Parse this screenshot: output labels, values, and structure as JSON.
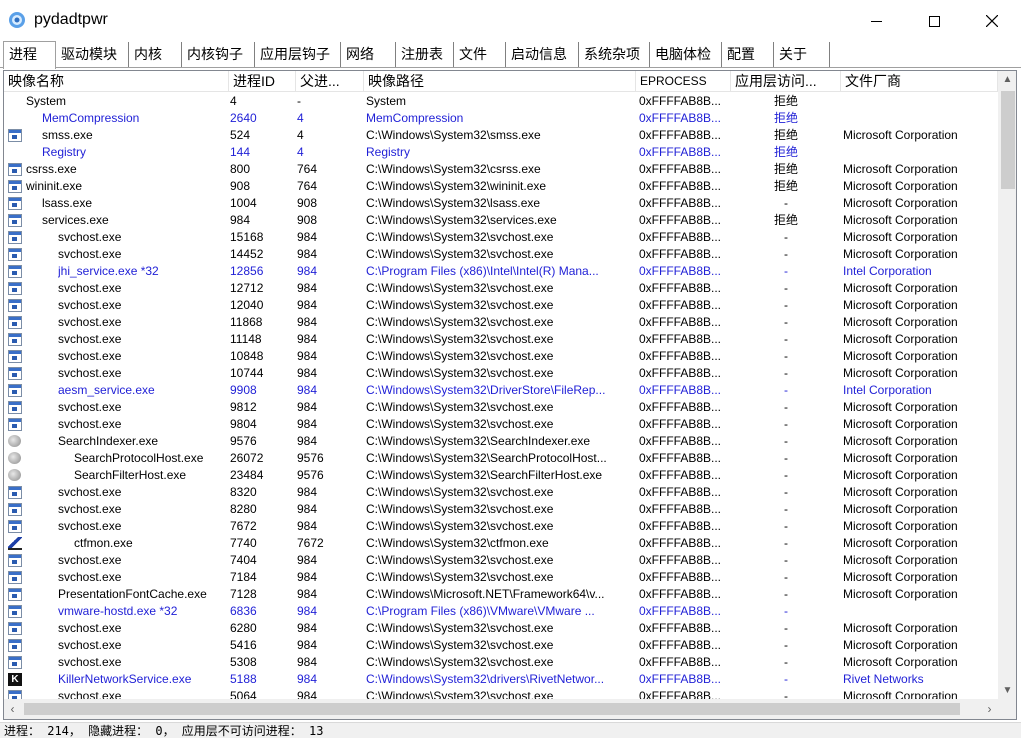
{
  "window": {
    "title": "pydadtpwr",
    "icon": "gear-flower-icon",
    "controls": [
      "minimize-icon",
      "maximize-icon",
      "close-icon"
    ]
  },
  "tabs": [
    {
      "label": "进程",
      "active": true
    },
    {
      "label": "驱动模块"
    },
    {
      "label": "内核"
    },
    {
      "label": "内核钩子"
    },
    {
      "label": "应用层钩子"
    },
    {
      "label": "网络"
    },
    {
      "label": "注册表"
    },
    {
      "label": "文件"
    },
    {
      "label": "启动信息"
    },
    {
      "label": "系统杂项"
    },
    {
      "label": "电脑体检"
    },
    {
      "label": "配置"
    },
    {
      "label": "关于"
    }
  ],
  "columns": [
    "映像名称",
    "进程ID",
    "父进...",
    "映像路径",
    "EPROCESS",
    "应用层访问...",
    "文件厂商"
  ],
  "colors": {
    "highlight_text": "#1f1fd6",
    "normal_text": "#000000"
  },
  "processes": [
    {
      "name": "System",
      "indent": 1,
      "icon": "none",
      "pid": "4",
      "ppid": "-",
      "path": "System",
      "eprocess": "0xFFFFAB8B...",
      "access": "拒绝",
      "vendor": "",
      "blue": false
    },
    {
      "name": "MemCompression",
      "indent": 2,
      "icon": "none",
      "pid": "2640",
      "ppid": "4",
      "path": "MemCompression",
      "eprocess": "0xFFFFAB8B...",
      "access": "拒绝",
      "vendor": "",
      "blue": true
    },
    {
      "name": "smss.exe",
      "indent": 2,
      "icon": "window",
      "pid": "524",
      "ppid": "4",
      "path": "C:\\Windows\\System32\\smss.exe",
      "eprocess": "0xFFFFAB8B...",
      "access": "拒绝",
      "vendor": "Microsoft Corporation",
      "blue": false
    },
    {
      "name": "Registry",
      "indent": 2,
      "icon": "none",
      "pid": "144",
      "ppid": "4",
      "path": "Registry",
      "eprocess": "0xFFFFAB8B...",
      "access": "拒绝",
      "vendor": "",
      "blue": true
    },
    {
      "name": "csrss.exe",
      "indent": 1,
      "icon": "window",
      "pid": "800",
      "ppid": "764",
      "path": "C:\\Windows\\System32\\csrss.exe",
      "eprocess": "0xFFFFAB8B...",
      "access": "拒绝",
      "vendor": "Microsoft Corporation",
      "blue": false
    },
    {
      "name": "wininit.exe",
      "indent": 1,
      "icon": "window",
      "pid": "908",
      "ppid": "764",
      "path": "C:\\Windows\\System32\\wininit.exe",
      "eprocess": "0xFFFFAB8B...",
      "access": "拒绝",
      "vendor": "Microsoft Corporation",
      "blue": false
    },
    {
      "name": "lsass.exe",
      "indent": 2,
      "icon": "window",
      "pid": "1004",
      "ppid": "908",
      "path": "C:\\Windows\\System32\\lsass.exe",
      "eprocess": "0xFFFFAB8B...",
      "access": "-",
      "vendor": "Microsoft Corporation",
      "blue": false
    },
    {
      "name": "services.exe",
      "indent": 2,
      "icon": "window",
      "pid": "984",
      "ppid": "908",
      "path": "C:\\Windows\\System32\\services.exe",
      "eprocess": "0xFFFFAB8B...",
      "access": "拒绝",
      "vendor": "Microsoft Corporation",
      "blue": false
    },
    {
      "name": "svchost.exe",
      "indent": 3,
      "icon": "window",
      "pid": "15168",
      "ppid": "984",
      "path": "C:\\Windows\\System32\\svchost.exe",
      "eprocess": "0xFFFFAB8B...",
      "access": "-",
      "vendor": "Microsoft Corporation",
      "blue": false
    },
    {
      "name": "svchost.exe",
      "indent": 3,
      "icon": "window",
      "pid": "14452",
      "ppid": "984",
      "path": "C:\\Windows\\System32\\svchost.exe",
      "eprocess": "0xFFFFAB8B...",
      "access": "-",
      "vendor": "Microsoft Corporation",
      "blue": false
    },
    {
      "name": "jhi_service.exe *32",
      "indent": 3,
      "icon": "window",
      "pid": "12856",
      "ppid": "984",
      "path": "C:\\Program Files (x86)\\Intel\\Intel(R) Mana...",
      "eprocess": "0xFFFFAB8B...",
      "access": "-",
      "vendor": "Intel Corporation",
      "blue": true
    },
    {
      "name": "svchost.exe",
      "indent": 3,
      "icon": "window",
      "pid": "12712",
      "ppid": "984",
      "path": "C:\\Windows\\System32\\svchost.exe",
      "eprocess": "0xFFFFAB8B...",
      "access": "-",
      "vendor": "Microsoft Corporation",
      "blue": false
    },
    {
      "name": "svchost.exe",
      "indent": 3,
      "icon": "window",
      "pid": "12040",
      "ppid": "984",
      "path": "C:\\Windows\\System32\\svchost.exe",
      "eprocess": "0xFFFFAB8B...",
      "access": "-",
      "vendor": "Microsoft Corporation",
      "blue": false
    },
    {
      "name": "svchost.exe",
      "indent": 3,
      "icon": "window",
      "pid": "11868",
      "ppid": "984",
      "path": "C:\\Windows\\System32\\svchost.exe",
      "eprocess": "0xFFFFAB8B...",
      "access": "-",
      "vendor": "Microsoft Corporation",
      "blue": false
    },
    {
      "name": "svchost.exe",
      "indent": 3,
      "icon": "window",
      "pid": "11148",
      "ppid": "984",
      "path": "C:\\Windows\\System32\\svchost.exe",
      "eprocess": "0xFFFFAB8B...",
      "access": "-",
      "vendor": "Microsoft Corporation",
      "blue": false
    },
    {
      "name": "svchost.exe",
      "indent": 3,
      "icon": "window",
      "pid": "10848",
      "ppid": "984",
      "path": "C:\\Windows\\System32\\svchost.exe",
      "eprocess": "0xFFFFAB8B...",
      "access": "-",
      "vendor": "Microsoft Corporation",
      "blue": false
    },
    {
      "name": "svchost.exe",
      "indent": 3,
      "icon": "window",
      "pid": "10744",
      "ppid": "984",
      "path": "C:\\Windows\\System32\\svchost.exe",
      "eprocess": "0xFFFFAB8B...",
      "access": "-",
      "vendor": "Microsoft Corporation",
      "blue": false
    },
    {
      "name": "aesm_service.exe",
      "indent": 3,
      "icon": "window",
      "pid": "9908",
      "ppid": "984",
      "path": "C:\\Windows\\System32\\DriverStore\\FileRep...",
      "eprocess": "0xFFFFAB8B...",
      "access": "-",
      "vendor": "Intel Corporation",
      "blue": true
    },
    {
      "name": "svchost.exe",
      "indent": 3,
      "icon": "window",
      "pid": "9812",
      "ppid": "984",
      "path": "C:\\Windows\\System32\\svchost.exe",
      "eprocess": "0xFFFFAB8B...",
      "access": "-",
      "vendor": "Microsoft Corporation",
      "blue": false
    },
    {
      "name": "svchost.exe",
      "indent": 3,
      "icon": "window",
      "pid": "9804",
      "ppid": "984",
      "path": "C:\\Windows\\System32\\svchost.exe",
      "eprocess": "0xFFFFAB8B...",
      "access": "-",
      "vendor": "Microsoft Corporation",
      "blue": false
    },
    {
      "name": "SearchIndexer.exe",
      "indent": 3,
      "icon": "search",
      "pid": "9576",
      "ppid": "984",
      "path": "C:\\Windows\\System32\\SearchIndexer.exe",
      "eprocess": "0xFFFFAB8B...",
      "access": "-",
      "vendor": "Microsoft Corporation",
      "blue": false
    },
    {
      "name": "SearchProtocolHost.exe",
      "indent": 4,
      "icon": "search",
      "pid": "26072",
      "ppid": "9576",
      "path": "C:\\Windows\\System32\\SearchProtocolHost...",
      "eprocess": "0xFFFFAB8B...",
      "access": "-",
      "vendor": "Microsoft Corporation",
      "blue": false
    },
    {
      "name": "SearchFilterHost.exe",
      "indent": 4,
      "icon": "search",
      "pid": "23484",
      "ppid": "9576",
      "path": "C:\\Windows\\System32\\SearchFilterHost.exe",
      "eprocess": "0xFFFFAB8B...",
      "access": "-",
      "vendor": "Microsoft Corporation",
      "blue": false
    },
    {
      "name": "svchost.exe",
      "indent": 3,
      "icon": "window",
      "pid": "8320",
      "ppid": "984",
      "path": "C:\\Windows\\System32\\svchost.exe",
      "eprocess": "0xFFFFAB8B...",
      "access": "-",
      "vendor": "Microsoft Corporation",
      "blue": false
    },
    {
      "name": "svchost.exe",
      "indent": 3,
      "icon": "window",
      "pid": "8280",
      "ppid": "984",
      "path": "C:\\Windows\\System32\\svchost.exe",
      "eprocess": "0xFFFFAB8B...",
      "access": "-",
      "vendor": "Microsoft Corporation",
      "blue": false
    },
    {
      "name": "svchost.exe",
      "indent": 3,
      "icon": "window",
      "pid": "7672",
      "ppid": "984",
      "path": "C:\\Windows\\System32\\svchost.exe",
      "eprocess": "0xFFFFAB8B...",
      "access": "-",
      "vendor": "Microsoft Corporation",
      "blue": false
    },
    {
      "name": "ctfmon.exe",
      "indent": 4,
      "icon": "pen",
      "pid": "7740",
      "ppid": "7672",
      "path": "C:\\Windows\\System32\\ctfmon.exe",
      "eprocess": "0xFFFFAB8B...",
      "access": "-",
      "vendor": "Microsoft Corporation",
      "blue": false
    },
    {
      "name": "svchost.exe",
      "indent": 3,
      "icon": "window",
      "pid": "7404",
      "ppid": "984",
      "path": "C:\\Windows\\System32\\svchost.exe",
      "eprocess": "0xFFFFAB8B...",
      "access": "-",
      "vendor": "Microsoft Corporation",
      "blue": false
    },
    {
      "name": "svchost.exe",
      "indent": 3,
      "icon": "window",
      "pid": "7184",
      "ppid": "984",
      "path": "C:\\Windows\\System32\\svchost.exe",
      "eprocess": "0xFFFFAB8B...",
      "access": "-",
      "vendor": "Microsoft Corporation",
      "blue": false
    },
    {
      "name": "PresentationFontCache.exe",
      "indent": 3,
      "icon": "window",
      "pid": "7128",
      "ppid": "984",
      "path": "C:\\Windows\\Microsoft.NET\\Framework64\\v...",
      "eprocess": "0xFFFFAB8B...",
      "access": "-",
      "vendor": "Microsoft Corporation",
      "blue": false
    },
    {
      "name": "vmware-hostd.exe *32",
      "indent": 3,
      "icon": "window",
      "pid": "6836",
      "ppid": "984",
      "path": "C:\\Program Files (x86)\\VMware\\VMware ...",
      "eprocess": "0xFFFFAB8B...",
      "access": "-",
      "vendor": "",
      "blue": true
    },
    {
      "name": "svchost.exe",
      "indent": 3,
      "icon": "window",
      "pid": "6280",
      "ppid": "984",
      "path": "C:\\Windows\\System32\\svchost.exe",
      "eprocess": "0xFFFFAB8B...",
      "access": "-",
      "vendor": "Microsoft Corporation",
      "blue": false
    },
    {
      "name": "svchost.exe",
      "indent": 3,
      "icon": "window",
      "pid": "5416",
      "ppid": "984",
      "path": "C:\\Windows\\System32\\svchost.exe",
      "eprocess": "0xFFFFAB8B...",
      "access": "-",
      "vendor": "Microsoft Corporation",
      "blue": false
    },
    {
      "name": "svchost.exe",
      "indent": 3,
      "icon": "window",
      "pid": "5308",
      "ppid": "984",
      "path": "C:\\Windows\\System32\\svchost.exe",
      "eprocess": "0xFFFFAB8B...",
      "access": "-",
      "vendor": "Microsoft Corporation",
      "blue": false
    },
    {
      "name": "KillerNetworkService.exe",
      "indent": 3,
      "icon": "killer",
      "pid": "5188",
      "ppid": "984",
      "path": "C:\\Windows\\System32\\drivers\\RivetNetwor...",
      "eprocess": "0xFFFFAB8B...",
      "access": "-",
      "vendor": "Rivet Networks",
      "blue": true
    },
    {
      "name": "svchost.exe",
      "indent": 3,
      "icon": "window",
      "pid": "5064",
      "ppid": "984",
      "path": "C:\\Windows\\System32\\svchost.exe",
      "eprocess": "0xFFFFAB8B...",
      "access": "-",
      "vendor": "Microsoft Corporation",
      "blue": false
    }
  ],
  "status": {
    "text": "进程： 214， 隐藏进程： 0， 应用层不可访问进程： 13"
  }
}
